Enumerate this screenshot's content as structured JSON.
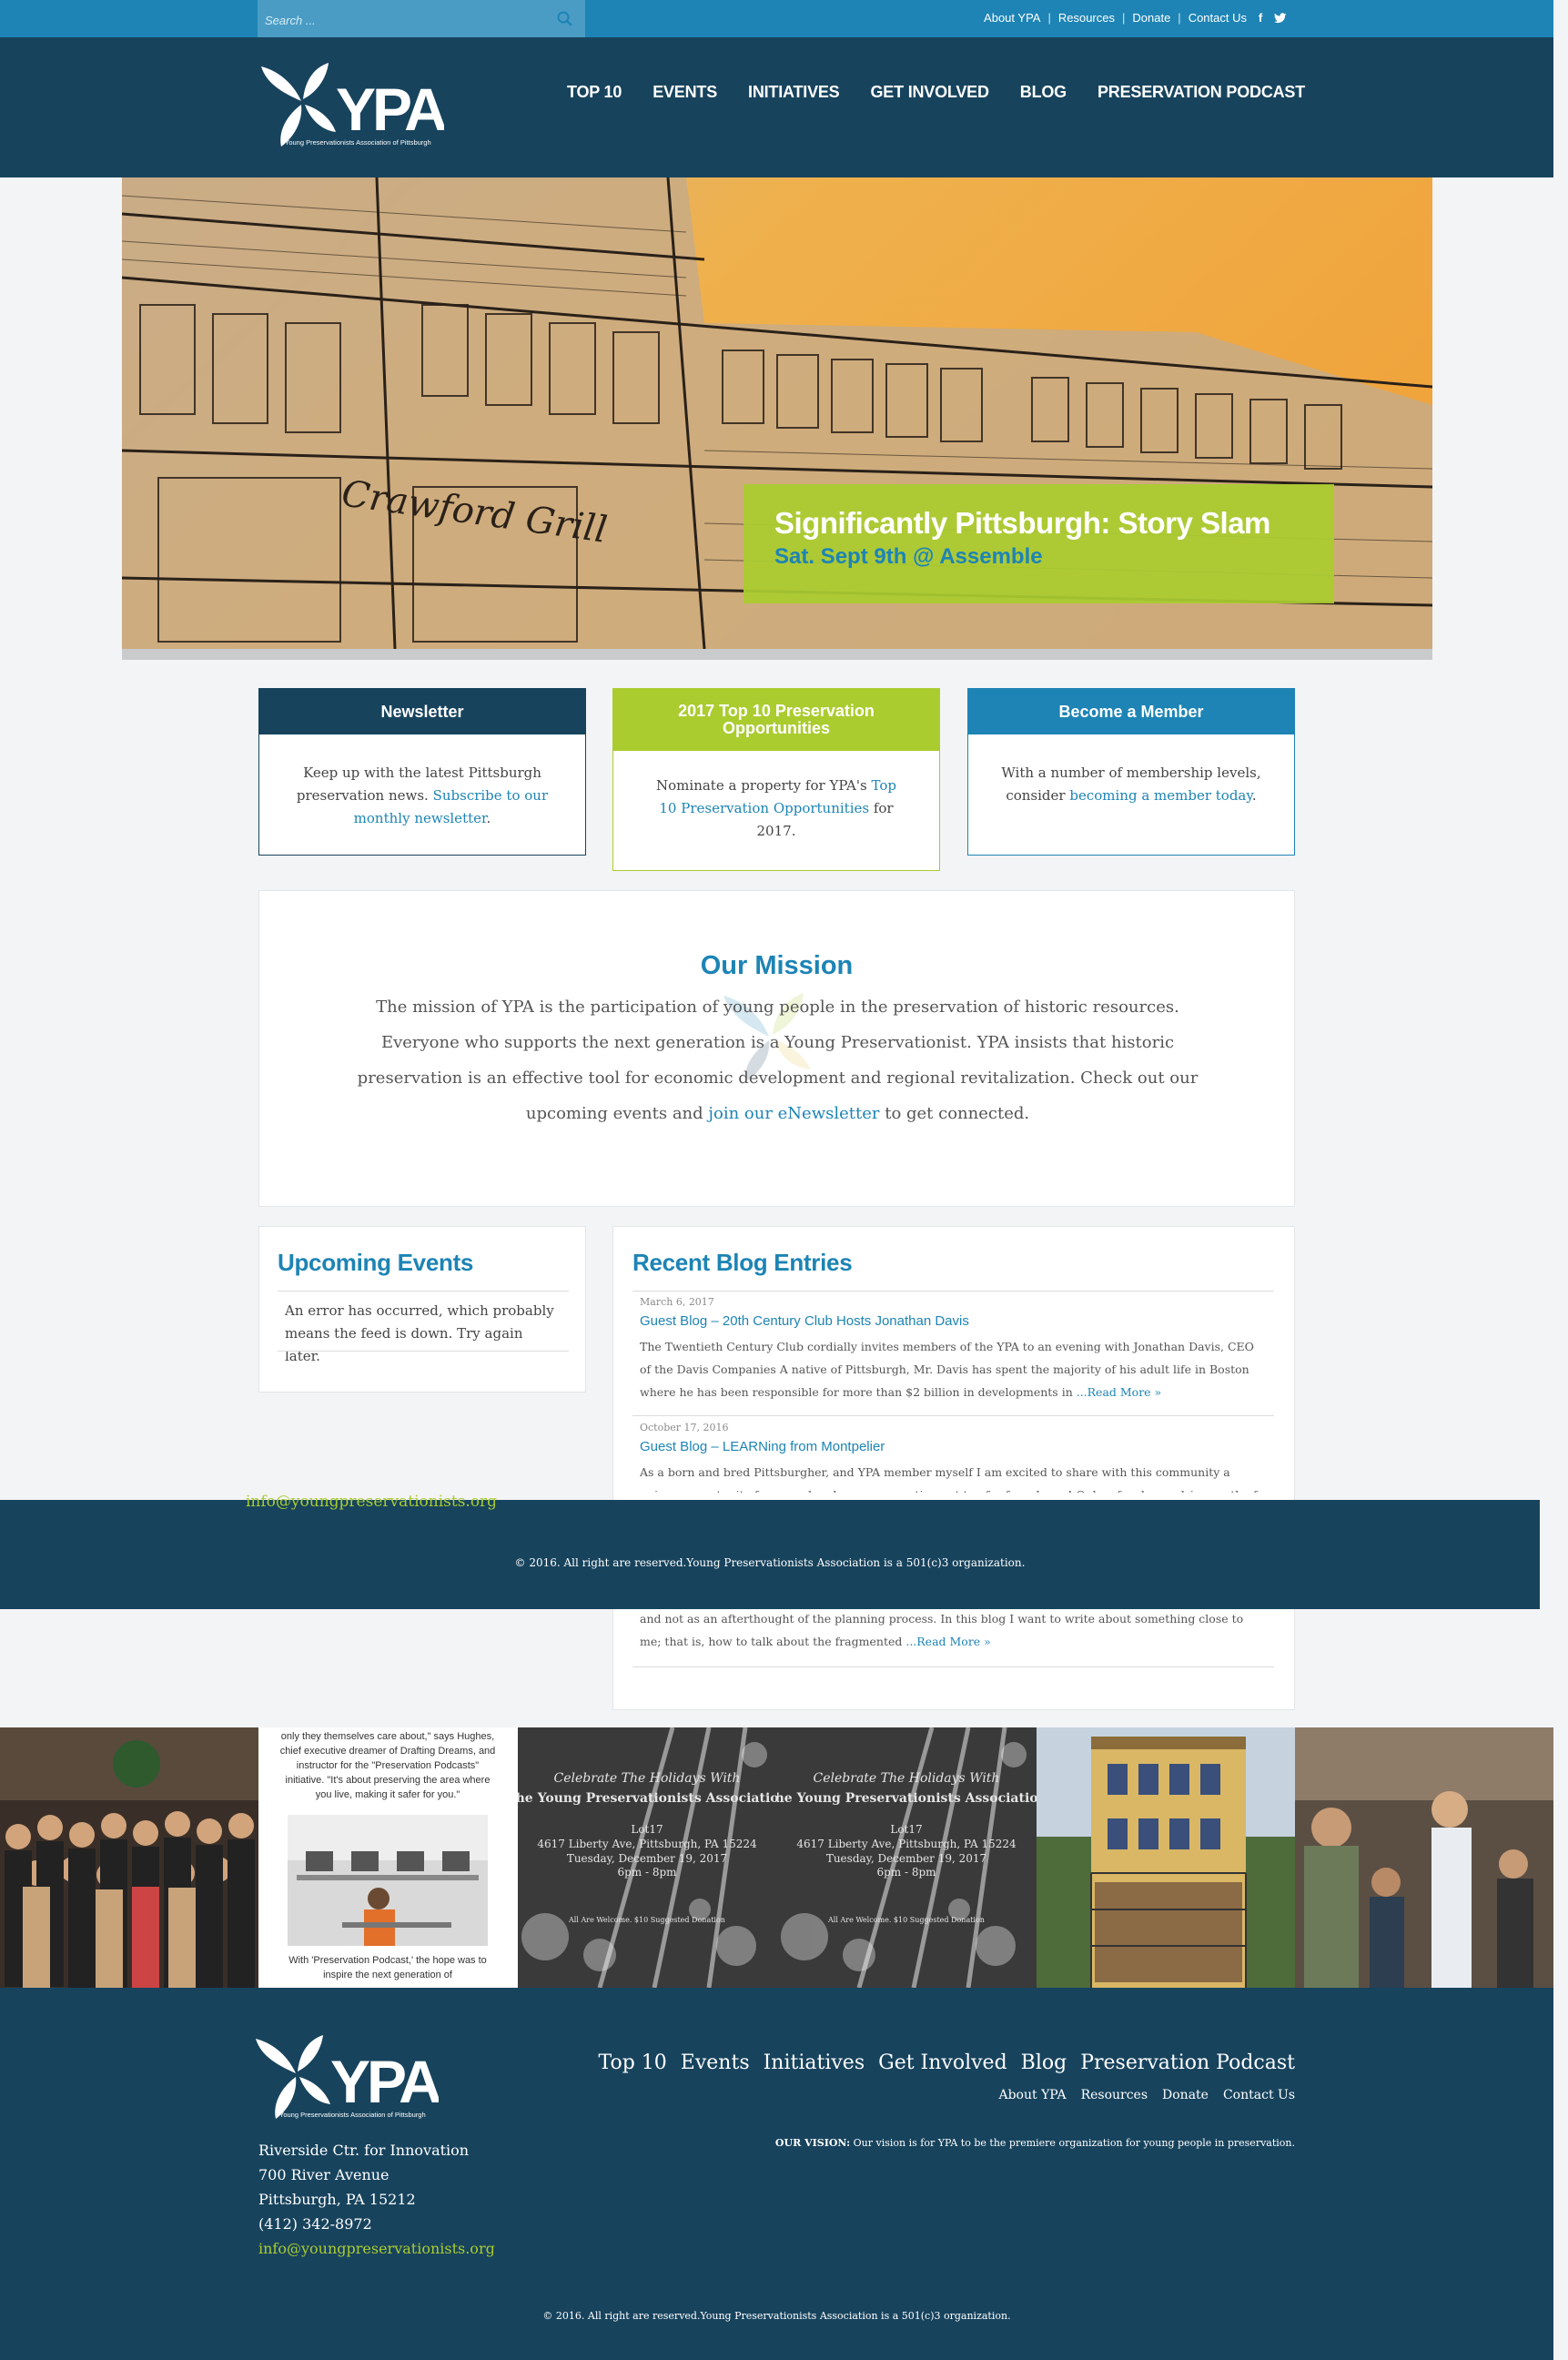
{
  "topbar": {
    "search_placeholder": "Search ...",
    "links": [
      "About YPA",
      "Resources",
      "Donate",
      "Contact Us"
    ],
    "social": [
      "facebook-icon",
      "twitter-icon"
    ]
  },
  "header": {
    "logo_text": "YPA",
    "logo_tagline": "Young Preservationists Association of Pittsburgh",
    "nav": [
      "TOP 10",
      "EVENTS",
      "INITIATIVES",
      "GET INVOLVED",
      "BLOG",
      "PRESERVATION PODCAST"
    ]
  },
  "hero": {
    "title": "Significantly Pittsburgh: Story Slam",
    "subtitle": "Sat. Sept 9th @ Assemble",
    "sign_text": "Crawford Grill"
  },
  "cards": {
    "newsletter": {
      "title": "Newsletter",
      "text": "Keep up with the latest Pittsburgh preservation news. ",
      "link": "Subscribe to our monthly newsletter",
      "after": "."
    },
    "top10": {
      "title": "2017 Top 10 Preservation Opportunities",
      "text": "Nominate a property for YPA's ",
      "link": "Top 10 Preservation Opportunities",
      "after": " for 2017."
    },
    "member": {
      "title": "Become a Member",
      "text": "With a number of membership levels, consider ",
      "link": "becoming a member today",
      "after": "."
    }
  },
  "mission": {
    "title": "Our Mission",
    "text": "The mission of YPA is the participation of young people in the preservation of historic resources. Everyone who supports the next generation is a Young Preservationist. YPA insists that historic preservation is an effective tool for economic development and regional revitalization. Check out our upcoming events and ",
    "link": "join our eNewsletter",
    "after": " to get connected."
  },
  "events": {
    "title": "Upcoming Events",
    "message": "An error has occurred, which probably means the feed is down. Try again later."
  },
  "blog": {
    "title": "Recent Blog Entries",
    "read_more": "...Read More »",
    "entries": [
      {
        "date": "March 6, 2017",
        "title": "Guest Blog – 20th Century Club Hosts Jonathan Davis",
        "excerpt": "The Twentieth Century Club cordially invites members of the YPA to an evening with Jonathan Davis, CEO of the Davis Companies A native of Pittsburgh, Mr. Davis has spent the majority of his adult life in Boston where he has been responsible for more than $2 billion in developments in "
      },
      {
        "date": "October 17, 2016",
        "title": "Guest Blog – LEARNing from Montpelier",
        "excerpt": "As a born and bred Pittsburgher, and YPA member myself I am excited to share with this community a unique opportunity for some hands-on preservation not too far from home! Only a few hours drive south of Pittsburgh, George"
      },
      {
        "excerpt": "and not as an afterthought of the planning process. In this blog I want to write about something close to me; that is, how to talk about the fragmented "
      }
    ]
  },
  "overlay_band": {
    "email": "info@youngpreservationists.org",
    "copyright": "© 2016. All right are reserved.Young Preservationists Association is a 501(c)3 organization."
  },
  "photo_strip": {
    "tile2_quote": "only they themselves care about,\" says Hughes, chief executive dreamer of Drafting Dreams, and instructor for the \"Preservation Podcasts\" initiative. \"It's about preserving the area where you live, making it safer for you.\"",
    "tile2_caption": "With 'Preservation Podcast,' the hope was to inspire the next generation of",
    "flyer": {
      "line1": "Celebrate The Holidays With",
      "line2": "The Young Preservationists Association",
      "line3": "Lot17",
      "line4": "4617 Liberty Ave, Pittsburgh, PA 15224",
      "line5": "Tuesday, December 19, 2017",
      "line6": "6pm - 8pm",
      "line7": "All Are Welcome. $10 Suggested Donation"
    }
  },
  "footer": {
    "nav": [
      "Top 10",
      "Events",
      "Initiatives",
      "Get Involved",
      "Blog",
      "Preservation Podcast"
    ],
    "util": [
      "About YPA",
      "Resources",
      "Donate",
      "Contact Us"
    ],
    "vision_label": "OUR VISION:",
    "vision_text": " Our vision is for YPA to be the premiere organization for young people in preservation.",
    "address": [
      "Riverside Ctr. for Innovation",
      "700 River Avenue",
      "Pittsburgh, PA 15212",
      "(412) 342-8972"
    ],
    "email": "info@youngpreservationists.org",
    "copyright": "© 2016. All right are reserved.Young Preservationists Association is a 501(c)3 organization."
  },
  "colors": {
    "dark_navy": "#17435d",
    "brand_blue": "#1d84b5",
    "lime": "#aacc2f"
  }
}
